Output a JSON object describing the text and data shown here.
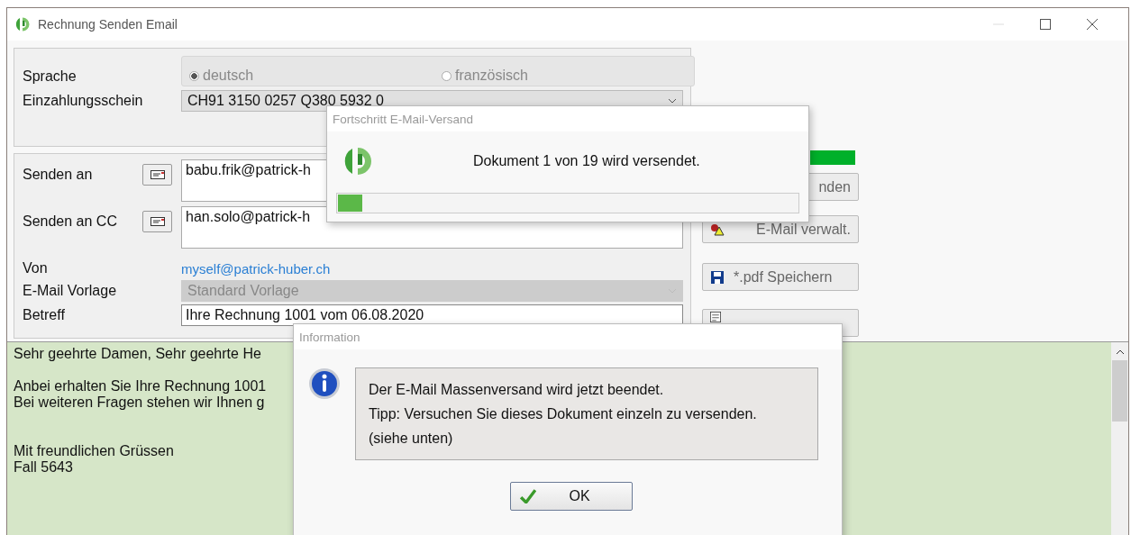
{
  "window": {
    "title": "Rechnung Senden Email"
  },
  "language": {
    "label": "Sprache",
    "disabled": true,
    "options": [
      {
        "label": "deutsch",
        "selected": true
      },
      {
        "label": "französisch",
        "selected": false
      }
    ]
  },
  "payment_slip": {
    "label": "Einzahlungsschein",
    "value": "CH91 3150 0257 Q380 5932 0"
  },
  "recipients": [
    {
      "label": "Senden an",
      "value": "babu.frik@patrick-h"
    },
    {
      "label": "Senden an CC",
      "value": "han.solo@patrick-h"
    }
  ],
  "sender": {
    "label": "Von",
    "value": "myself@patrick-huber.ch"
  },
  "template": {
    "label": "E-Mail Vorlage",
    "value": "Standard Vorlage",
    "disabled": true
  },
  "subject": {
    "label": "Betreff",
    "value": "Ihre Rechnung 1001 vom 06.08.2020"
  },
  "actions": [
    {
      "kind": "send",
      "label": "nden"
    },
    {
      "kind": "manage",
      "label": "E-Mail verwalt."
    },
    {
      "kind": "save",
      "label": "*.pdf Speichern"
    },
    {
      "kind": "sign"
    }
  ],
  "body": {
    "paragraphs": [
      {
        "lines": [
          "Sehr geehrte Damen, Sehr geehrte He"
        ]
      },
      {
        "lines": [
          "Anbei erhalten Sie Ihre Rechnung 1001",
          "Bei weiteren Fragen stehen wir Ihnen g"
        ]
      },
      {
        "lines": [
          "Mit freundlichen Grüssen",
          "Fall 5643"
        ]
      }
    ]
  },
  "progress_dialog": {
    "title": "Fortschritt E-Mail-Versand",
    "message": "Dokument 1 von 19 wird versendet.",
    "level": 0.053
  },
  "info_dialog": {
    "title": "Information",
    "lines": [
      "Der E-Mail Massenversand wird jetzt beendet.",
      "Tipp: Versuchen Sie dieses Dokument einzeln zu versenden.",
      "(siehe unten)"
    ],
    "button": "OK"
  }
}
